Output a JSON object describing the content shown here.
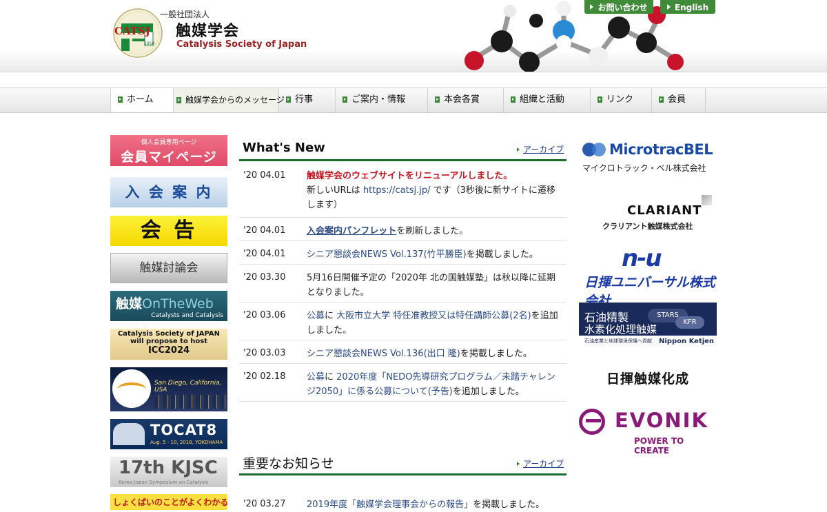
{
  "header": {
    "logo_mark": "CATSJ",
    "logo_year": "1958",
    "logo_pre": "一般社団法人",
    "logo_jp": "触媒学会",
    "logo_en": "Catalysis Society of Japan",
    "contact_label": "お問い合わせ",
    "english_label": "English"
  },
  "nav": {
    "items": [
      "ホーム",
      "触媒学会からのメッセージ",
      "行事",
      "ご案内・情報",
      "本会各賞",
      "組織と活動",
      "リンク",
      "会員"
    ]
  },
  "left_banners": {
    "mypage_small": "個人会員専用ページ",
    "mypage": "会員マイページ",
    "join": "入 会 案 内",
    "notice": "会 告",
    "forum": "触媒討論会",
    "otw_a": "触媒",
    "otw_b": "OnTheWeb",
    "otw_sub": "Catalysts and Catalysis",
    "icc_1": "Catalysis Society of JAPAN",
    "icc_2": "will propose to host",
    "icc_3": "ICC2024",
    "icc17": "San Diego, California, USA",
    "tocat": "TOCAT8",
    "tocat_sub": "Aug. 5 - 10, 2018, YOKOHAMA",
    "kjsc": "17th KJSC",
    "kjsc_sub": "Korea-Japan Symposium on Catalysis",
    "last": "しょくばいのことがよくわかる!"
  },
  "whats_new": {
    "title": "What's New",
    "archive": "アーカイブ",
    "items": [
      {
        "date": "'20 04.01",
        "t1": "触媒学会のウェブサイトをリニューアルしました。",
        "t2": "新しいURLは ",
        "link": "https://catsj.jp/",
        "t3": " です（3秒後に新サイトに遷移します）"
      },
      {
        "date": "'20 04.01",
        "link": "入会案内パンフレット",
        "t3": "を刷新しました。"
      },
      {
        "date": "'20 04.01",
        "link": "シニア懇談会NEWS Vol.137(竹平勝臣)",
        "t3": "を掲載しました。"
      },
      {
        "date": "'20 03.30",
        "t3": "5月16日開催予定の「2020年 北の国触媒塾」は秋以降に延期となりました。"
      },
      {
        "date": "'20 03.06",
        "link": "公募",
        "t2": "に ",
        "link2": "大阪市立大学 特任准教授又は特任講師公募(2名)",
        "t3": "を追加しました。"
      },
      {
        "date": "'20 03.03",
        "link": "シニア懇談会NEWS Vol.136(出口 隆)",
        "t3": "を掲載しました。"
      },
      {
        "date": "'20 02.18",
        "link": "公募",
        "t2": "に ",
        "link2": "2020年度「NEDO先導研究プログラム／未踏チャレンジ2050」に係る公募について(予告)",
        "t3": "を追加しました。"
      }
    ]
  },
  "important": {
    "title": "重要なお知らせ",
    "archive": "アーカイブ",
    "items": [
      {
        "date": "'20 03.27",
        "link": "2019年度「触媒学会理事会からの報告」",
        "t3": "を掲載しました。"
      }
    ]
  },
  "sponsors": {
    "microtrac": "MicrotracBEL",
    "microtrac_jp": "マイクロトラック・ベル株式会社",
    "clariant": "CLARIANT",
    "clariant_jp": "クラリアント触媒株式会社",
    "nu": "n-u",
    "nu_jp": "日揮ユニバーサル株式会社",
    "nk_1": "石油精製",
    "nk_2": "水素化処理触媒",
    "nk_stars": "STARS",
    "nk_kfr": "KFR",
    "nk_sub": "石油産業と地球環境保護へ貢献",
    "nk_brand": "Nippon Ketjen",
    "jgc": "日揮触媒化成",
    "evonik": "EVONIK",
    "evonik_sub": "POWER TO CREATE"
  }
}
